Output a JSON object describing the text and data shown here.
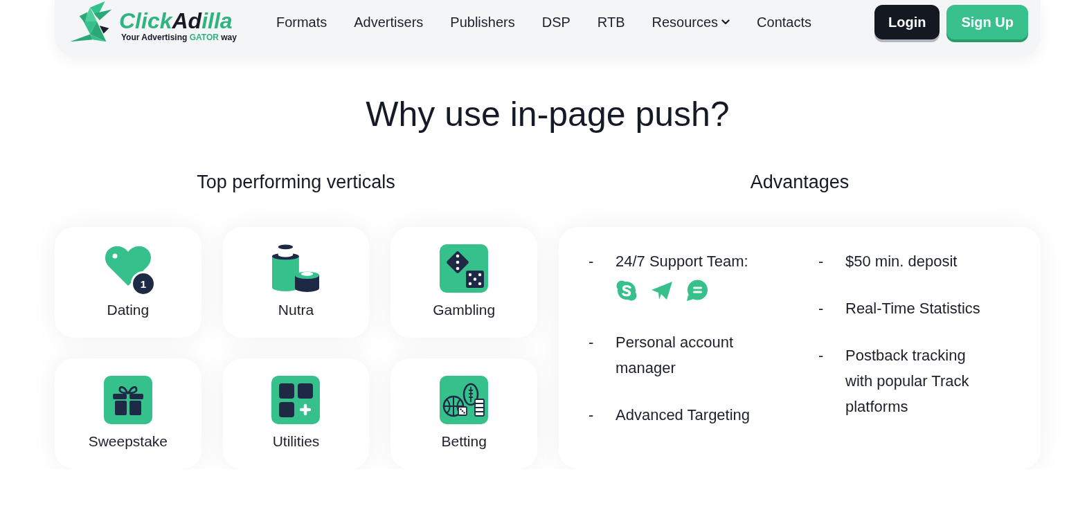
{
  "header": {
    "logo": {
      "wordmark": [
        {
          "text": "Click",
          "accent": true
        },
        {
          "text": "Ad",
          "accent": false
        },
        {
          "text": "illa",
          "accent": true
        }
      ],
      "tagline": [
        {
          "text": "Your Advertising ",
          "accent": false
        },
        {
          "text": "GATOR",
          "accent": true
        },
        {
          "text": " way",
          "accent": false
        }
      ]
    },
    "nav": [
      {
        "label": "Formats",
        "dropdown": false
      },
      {
        "label": "Advertisers",
        "dropdown": false
      },
      {
        "label": "Publishers",
        "dropdown": false
      },
      {
        "label": "DSP",
        "dropdown": false
      },
      {
        "label": "RTB",
        "dropdown": false
      },
      {
        "label": "Resources",
        "dropdown": true
      },
      {
        "label": "Contacts",
        "dropdown": false
      }
    ],
    "buttons": [
      {
        "label": "Login",
        "kind": "dark"
      },
      {
        "label": "Sign Up",
        "kind": "primary"
      }
    ]
  },
  "title": "Why use in-page push?",
  "verticals": {
    "heading": "Top performing verticals",
    "items": [
      {
        "label": "Dating",
        "kind": "dating",
        "badge": "1"
      },
      {
        "label": "Nutra",
        "kind": "nutra"
      },
      {
        "label": "Gambling",
        "kind": "gambling"
      },
      {
        "label": "Sweepstake",
        "kind": "sweepstake"
      },
      {
        "label": "Utilities",
        "kind": "utilities"
      },
      {
        "label": "Betting",
        "kind": "betting"
      }
    ]
  },
  "advantages": {
    "heading": "Advantages",
    "columns": [
      {
        "items": [
          {
            "bullet": "-",
            "text": "24/7 Support Team:",
            "contacts": [
              {
                "kind": "skype"
              },
              {
                "kind": "telegram"
              },
              {
                "kind": "chat"
              }
            ]
          },
          {
            "bullet": "-",
            "text": "Personal account manager"
          },
          {
            "bullet": "-",
            "text": "Advanced Targeting"
          }
        ]
      },
      {
        "items": [
          {
            "bullet": "-",
            "text": "$50 min. deposit"
          },
          {
            "bullet": "-",
            "text": "Real-Time Statistics"
          },
          {
            "bullet": "-",
            "text": "Postback tracking with popular Track platforms"
          }
        ]
      }
    ]
  }
}
